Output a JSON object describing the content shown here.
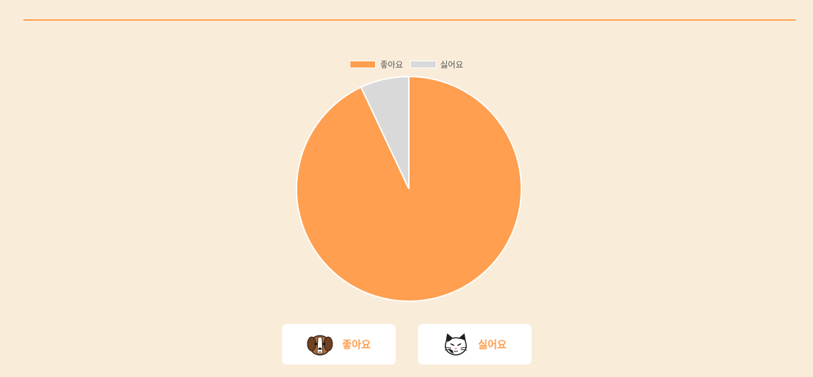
{
  "chart_data": {
    "type": "pie",
    "categories": [
      "좋아요",
      "싫어요"
    ],
    "values": [
      93,
      7
    ],
    "colors": [
      "#ff9f4f",
      "#d9d9d9"
    ],
    "start_angle_deg": 0,
    "legend_position": "top",
    "title": ""
  },
  "buttons": {
    "like": {
      "label": "좋아요",
      "icon": "dog-face-icon"
    },
    "dislike": {
      "label": "싫어요",
      "icon": "cat-face-icon"
    }
  },
  "colors": {
    "accent": "#ff9f4f",
    "background": "#f9ecd9",
    "muted": "#d9d9d9"
  }
}
